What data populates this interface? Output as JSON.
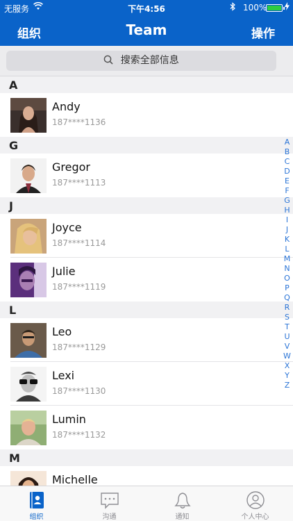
{
  "status_bar": {
    "carrier": "无服务",
    "time": "下午4:56",
    "battery": "100%"
  },
  "nav": {
    "left": "组织",
    "title": "Team",
    "right": "操作"
  },
  "search": {
    "placeholder": "搜索全部信息"
  },
  "sections": [
    {
      "letter": "A",
      "contacts": [
        {
          "name": "Andy",
          "phone": "187****1136"
        }
      ]
    },
    {
      "letter": "G",
      "contacts": [
        {
          "name": "Gregor",
          "phone": "187****1113"
        }
      ]
    },
    {
      "letter": "J",
      "contacts": [
        {
          "name": "Joyce",
          "phone": "187****1114"
        },
        {
          "name": "Julie",
          "phone": "187****1119"
        }
      ]
    },
    {
      "letter": "L",
      "contacts": [
        {
          "name": "Leo",
          "phone": "187****1129"
        },
        {
          "name": "Lexi",
          "phone": "187****1130"
        },
        {
          "name": "Lumin",
          "phone": "187****1132"
        }
      ]
    },
    {
      "letter": "M",
      "contacts": [
        {
          "name": "Michelle",
          "phone": ""
        }
      ]
    }
  ],
  "index_letters": [
    "A",
    "B",
    "C",
    "D",
    "E",
    "F",
    "G",
    "H",
    "I",
    "J",
    "K",
    "L",
    "M",
    "N",
    "O",
    "P",
    "Q",
    "R",
    "S",
    "T",
    "U",
    "V",
    "W",
    "X",
    "Y",
    "Z"
  ],
  "tabs": [
    {
      "label": "组织",
      "icon": "contacts-book-icon",
      "active": true
    },
    {
      "label": "沟通",
      "icon": "chat-bubble-icon",
      "active": false
    },
    {
      "label": "通知",
      "icon": "bell-icon",
      "active": false
    },
    {
      "label": "个人中心",
      "icon": "user-profile-icon",
      "active": false
    }
  ],
  "colors": {
    "brand": "#0a63c9",
    "index": "#2a74d6",
    "tab_inactive": "#8e8e93"
  }
}
